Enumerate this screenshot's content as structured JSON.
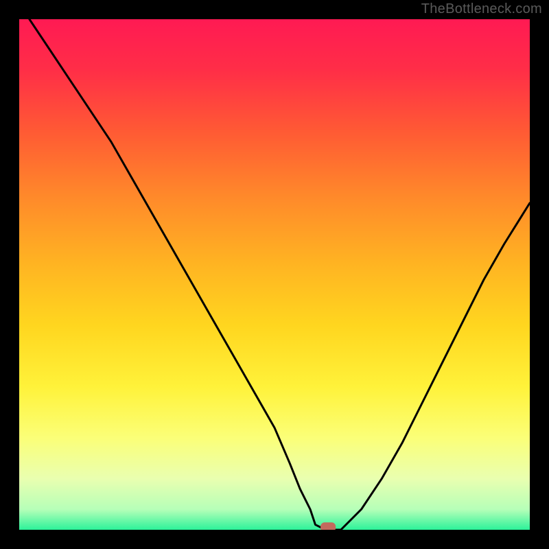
{
  "watermark": "TheBottleneck.com",
  "chart_data": {
    "type": "line",
    "title": "",
    "xlabel": "",
    "ylabel": "",
    "xlim": [
      0,
      100
    ],
    "ylim": [
      0,
      100
    ],
    "grid": false,
    "series": [
      {
        "name": "curve",
        "x": [
          2,
          6,
          10,
          14,
          18,
          22,
          26,
          30,
          34,
          38,
          42,
          46,
          50,
          53,
          55,
          57,
          58,
          60,
          63,
          67,
          71,
          75,
          79,
          83,
          87,
          91,
          95,
          100
        ],
        "y": [
          100,
          94,
          88,
          82,
          76,
          69,
          62,
          55,
          48,
          41,
          34,
          27,
          20,
          13,
          8,
          4,
          1,
          0,
          0,
          4,
          10,
          17,
          25,
          33,
          41,
          49,
          56,
          64
        ]
      }
    ],
    "marker": {
      "x": 60.5,
      "y": 0.5,
      "color": "#c36a5d"
    },
    "gradient_stops": [
      {
        "offset": 0.0,
        "color": "#ff1a53"
      },
      {
        "offset": 0.1,
        "color": "#ff2e47"
      },
      {
        "offset": 0.22,
        "color": "#ff5a34"
      },
      {
        "offset": 0.35,
        "color": "#ff8a2a"
      },
      {
        "offset": 0.48,
        "color": "#ffb422"
      },
      {
        "offset": 0.6,
        "color": "#ffd61f"
      },
      {
        "offset": 0.72,
        "color": "#fff23a"
      },
      {
        "offset": 0.82,
        "color": "#fbff78"
      },
      {
        "offset": 0.9,
        "color": "#e9ffb0"
      },
      {
        "offset": 0.96,
        "color": "#b6ffb8"
      },
      {
        "offset": 1.0,
        "color": "#2cf29a"
      }
    ]
  }
}
